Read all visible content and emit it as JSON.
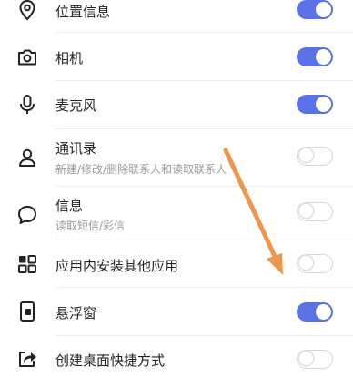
{
  "permissions": [
    {
      "label": "位置信息",
      "sub": "",
      "icon": "location-pin-icon",
      "enabled": true
    },
    {
      "label": "相机",
      "sub": "",
      "icon": "camera-icon",
      "enabled": true
    },
    {
      "label": "麦克风",
      "sub": "",
      "icon": "microphone-icon",
      "enabled": true
    },
    {
      "label": "通讯录",
      "sub": "新建/修改/删除联系人和读取联系人",
      "icon": "contact-person-icon",
      "enabled": false
    },
    {
      "label": "信息",
      "sub": "读取短信/彩信",
      "icon": "message-bubble-icon",
      "enabled": false
    },
    {
      "label": "应用内安装其他应用",
      "sub": "",
      "icon": "app-grid-icon",
      "enabled": false
    },
    {
      "label": "悬浮窗",
      "sub": "",
      "icon": "floating-window-icon",
      "enabled": true
    },
    {
      "label": "创建桌面快捷方式",
      "sub": "",
      "icon": "shortcut-share-icon",
      "enabled": false
    }
  ],
  "colors": {
    "toggle_on": "#5a72e6",
    "toggle_off_border": "#d6d6d6",
    "annotation_arrow": "#f0954a"
  }
}
